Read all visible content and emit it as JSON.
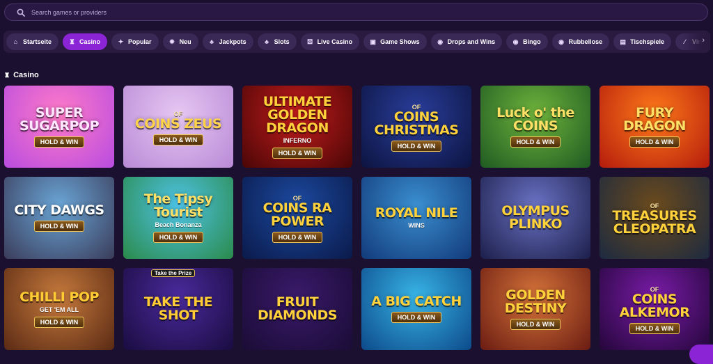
{
  "search": {
    "placeholder": "Search games or providers"
  },
  "nav": {
    "items": [
      {
        "label": "Startseite",
        "icon": "house-icon",
        "active": false
      },
      {
        "label": "Casino",
        "icon": "casino-icon",
        "active": true
      },
      {
        "label": "Popular",
        "icon": "flame-icon",
        "active": false
      },
      {
        "label": "Neu",
        "icon": "sparkle-icon",
        "active": false
      },
      {
        "label": "Jackpots",
        "icon": "cherries-icon",
        "active": false
      },
      {
        "label": "Slots",
        "icon": "slot-icon",
        "active": false
      },
      {
        "label": "Live Casino",
        "icon": "dice-icon",
        "active": false
      },
      {
        "label": "Game Shows",
        "icon": "tv-icon",
        "active": false
      },
      {
        "label": "Drops and Wins",
        "icon": "chip-icon",
        "active": false
      },
      {
        "label": "Bingo",
        "icon": "chip-icon",
        "active": false
      },
      {
        "label": "Rubbellose",
        "icon": "chip-icon",
        "active": false
      },
      {
        "label": "Tischspiele",
        "icon": "cards-icon",
        "active": false
      },
      {
        "label": "Virtual",
        "icon": "wand-icon",
        "active": false
      }
    ]
  },
  "section": {
    "title": "Casino",
    "icon": "casino-icon"
  },
  "games": [
    {
      "title": "SUPER SUGARPOP",
      "sub": "",
      "badge": "HOLD & WIN",
      "top": "",
      "bg": [
        "#ff7ac7",
        "#b84ce0"
      ],
      "color": "#ffe8ff"
    },
    {
      "title": "COINS ZEUS",
      "sub": "OF",
      "badge": "HOLD & WIN",
      "top": "",
      "bg": [
        "#e6c7f2",
        "#b98ad6"
      ],
      "color": "#ffd44a"
    },
    {
      "title": "ULTIMATE GOLDEN DRAGON",
      "sub": "INFERNO",
      "badge": "HOLD & WIN",
      "top": "",
      "bg": [
        "#c41c1c",
        "#4a0606"
      ],
      "color": "#ffd23c"
    },
    {
      "title": "COINS CHRISTMAS",
      "sub": "OF",
      "badge": "HOLD & WIN",
      "top": "",
      "bg": [
        "#2a3e9c",
        "#0c1440"
      ],
      "color": "#ffd23c"
    },
    {
      "title": "Luck o' the COINS",
      "sub": "",
      "badge": "HOLD & WIN",
      "top": "",
      "bg": [
        "#6fb33c",
        "#1f5a22"
      ],
      "color": "#ffe066"
    },
    {
      "title": "FURY DRAGON",
      "sub": "",
      "badge": "HOLD & WIN",
      "top": "",
      "bg": [
        "#ff7a1a",
        "#b31c0c"
      ],
      "color": "#ffe066"
    },
    {
      "title": "CITY DAWGS",
      "sub": "",
      "badge": "HOLD & WIN",
      "top": "",
      "bg": [
        "#6aa5d6",
        "#3a3c5a"
      ],
      "color": "#ffffff"
    },
    {
      "title": "The Tipsy Tourist",
      "sub": "Beach Bonanza",
      "badge": "HOLD & WIN",
      "top": "",
      "bg": [
        "#4ec3e6",
        "#2a8a4a"
      ],
      "color": "#ffe066"
    },
    {
      "title": "COINS RA POWER",
      "sub": "OF",
      "badge": "HOLD & WIN",
      "top": "",
      "bg": [
        "#1c4aa0",
        "#0a1a4a"
      ],
      "color": "#ffd23c"
    },
    {
      "title": "ROYAL NILE",
      "sub": "WINS",
      "badge": "",
      "top": "",
      "bg": [
        "#3a8fd0",
        "#123a7a"
      ],
      "color": "#ffd23c"
    },
    {
      "title": "OLYMPUS PLINKO",
      "sub": "",
      "badge": "",
      "top": "",
      "bg": [
        "#6a72c4",
        "#1c1f4a"
      ],
      "color": "#ffd23c"
    },
    {
      "title": "TREASURES CLEOPATRA",
      "sub": "OF",
      "badge": "",
      "top": "",
      "bg": [
        "#6b4a1c",
        "#1c2a40"
      ],
      "color": "#ffd23c"
    },
    {
      "title": "CHILLI POP",
      "sub": "GET 'EM ALL",
      "badge": "HOLD & WIN",
      "top": "",
      "bg": [
        "#c67a3c",
        "#5a2a14"
      ],
      "color": "#ffcc33"
    },
    {
      "title": "TAKE THE SHOT",
      "sub": "",
      "badge": "",
      "top": "Take the Prize",
      "bg": [
        "#4a2a9c",
        "#1a0c40"
      ],
      "color": "#ffcc33"
    },
    {
      "title": "FRUIT DIAMONDS",
      "sub": "",
      "badge": "",
      "top": "",
      "bg": [
        "#3a1a6a",
        "#1a0c36"
      ],
      "color": "#ffd23c"
    },
    {
      "title": "A BIG CATCH",
      "sub": "",
      "badge": "HOLD & WIN",
      "top": "",
      "bg": [
        "#38b4e6",
        "#0c4a8a"
      ],
      "color": "#ffd23c"
    },
    {
      "title": "GOLDEN DESTINY",
      "sub": "",
      "badge": "HOLD & WIN",
      "top": "",
      "bg": [
        "#d6743a",
        "#6a1c12"
      ],
      "color": "#ffd23c"
    },
    {
      "title": "COINS ALKEMOR",
      "sub": "OF",
      "badge": "HOLD & WIN",
      "top": "",
      "bg": [
        "#7a1ca8",
        "#24063a"
      ],
      "color": "#ffd23c"
    }
  ],
  "colors": {
    "background": "#1c1030",
    "accent": "#8a24d4",
    "chip": "#3a2856"
  }
}
